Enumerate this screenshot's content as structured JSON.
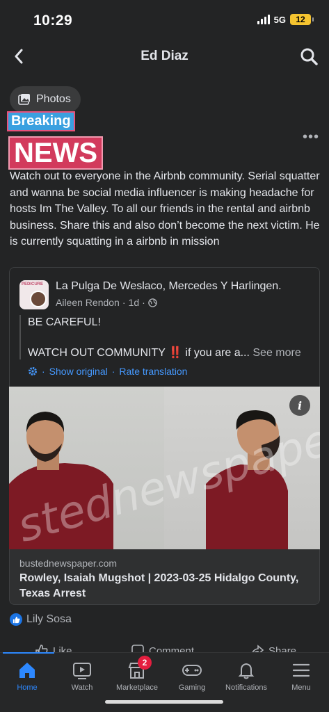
{
  "status": {
    "time": "10:29",
    "network": "5G",
    "battery": "12"
  },
  "header": {
    "title": "Ed Diaz"
  },
  "post": {
    "photos_label": "Photos",
    "banner_top": "Breaking",
    "banner_main": "NEWS",
    "text": "Watch out to everyone in the Airbnb community. Serial squatter and wanna be social media influencer is making headache for hosts Im The Valley. To all our friends in the rental and airbnb business. Share this and also don’t become the next victim. He is currently squatting in a airbnb in mission",
    "more_label": "•••"
  },
  "shared": {
    "avatar_text": "PEDICURE",
    "page_name": "La Pulga De Weslaco, Mercedes Y Harlingen.",
    "author": "Aileen Rendon",
    "age": "1d",
    "line1": "BE CAREFUL!",
    "line2": "WATCH OUT COMMUNITY ‼️ if you are a...",
    "see_more": "See more",
    "show_original": "Show original",
    "rate_translation": "Rate translation",
    "separator": "·"
  },
  "media": {
    "watermark": "stednewspaper.c",
    "info": "i"
  },
  "link": {
    "domain": "bustednewspaper.com",
    "title": "Rowley, Isaiah Mugshot | 2023-03-25 Hidalgo County, Texas Arrest"
  },
  "reactions": {
    "names": "Lily Sosa"
  },
  "actions": {
    "like": "Like",
    "comment": "Comment",
    "share": "Share"
  },
  "nav": {
    "items": [
      {
        "label": "Home",
        "icon": "home-icon"
      },
      {
        "label": "Watch",
        "icon": "watch-icon"
      },
      {
        "label": "Marketplace",
        "icon": "marketplace-icon",
        "badge": "2"
      },
      {
        "label": "Gaming",
        "icon": "gaming-icon"
      },
      {
        "label": "Notifications",
        "icon": "bell-icon"
      },
      {
        "label": "Menu",
        "icon": "menu-icon"
      }
    ]
  },
  "colors": {
    "accent": "#2d88ff",
    "banner_blue": "#3aa0e0",
    "banner_red": "#d23a5c",
    "badge_red": "#e41e3f"
  }
}
